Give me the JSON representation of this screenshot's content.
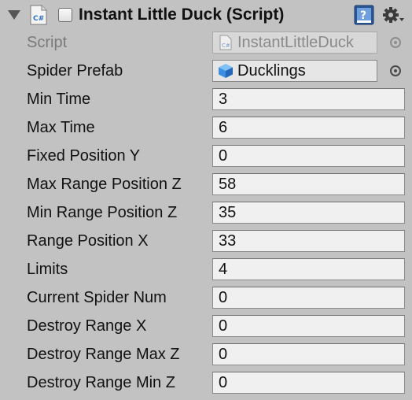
{
  "component": {
    "title": "Instant Little Duck (Script)",
    "enabled": false,
    "icons": {
      "script": "cs-script-icon",
      "help": "help-book-icon",
      "gear": "gear-icon",
      "foldout": "triangle-down-icon",
      "prefab": "prefab-cube-icon"
    }
  },
  "script_row": {
    "label": "Script",
    "value": "InstantLittleDuck"
  },
  "prefab_row": {
    "label": "Spider Prefab",
    "value": "Ducklings"
  },
  "fields": [
    {
      "label": "Min Time",
      "value": "3"
    },
    {
      "label": "Max Time",
      "value": "6"
    },
    {
      "label": "Fixed Position Y",
      "value": "0"
    },
    {
      "label": "Max Range Position Z",
      "value": "58"
    },
    {
      "label": "Min Range Position Z",
      "value": "35"
    },
    {
      "label": "Range Position X",
      "value": "33"
    },
    {
      "label": "Limits",
      "value": "4"
    },
    {
      "label": "Current Spider Num",
      "value": "0"
    },
    {
      "label": "Destroy Range X",
      "value": "0"
    },
    {
      "label": "Destroy Range Max Z",
      "value": "0"
    },
    {
      "label": "Destroy Range Min Z",
      "value": "0"
    }
  ],
  "colors": {
    "panel_bg": "#c2c2c2",
    "field_bg": "#f0f0f0",
    "disabled_text": "#7a7a7a",
    "prefab_blue": "#3d8ee0"
  }
}
